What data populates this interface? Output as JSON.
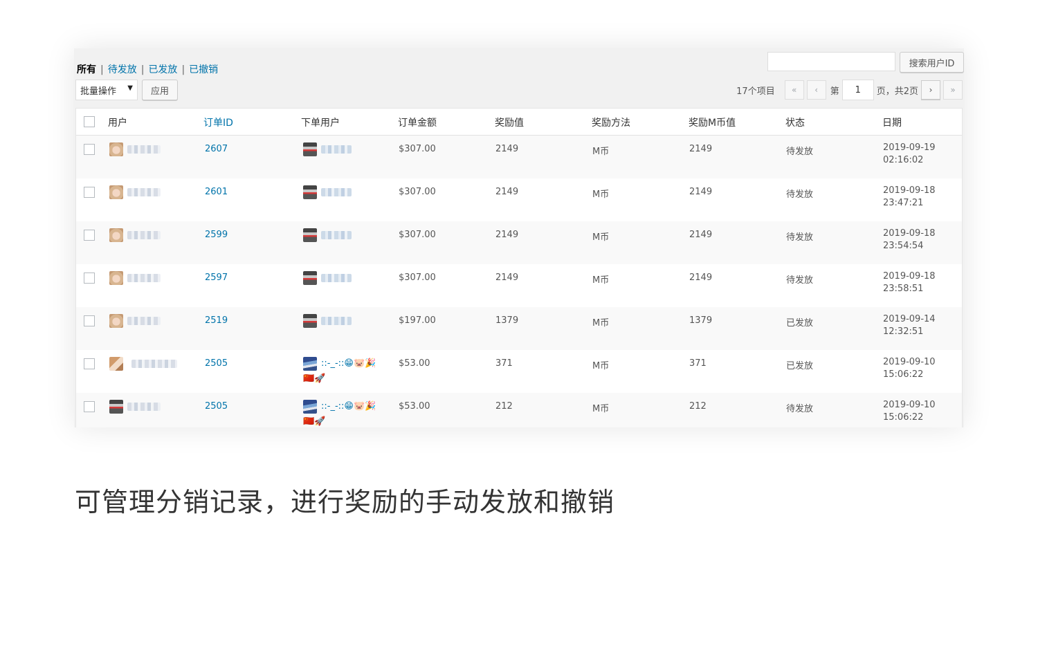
{
  "filters": {
    "all": "所有",
    "pending": "待发放",
    "issued": "已发放",
    "revoked": "已撤销",
    "separator": "|"
  },
  "search": {
    "input_value": "",
    "button_label": "搜索用户ID"
  },
  "bulk": {
    "select_label": "批量操作",
    "apply_label": "应用"
  },
  "pagination": {
    "items_count": "17个项目",
    "first": "«",
    "prev": "‹",
    "page_prefix": "第",
    "current_page": "1",
    "page_suffix": "页，共2页",
    "next": "›",
    "last": "»"
  },
  "columns": {
    "user": "用户",
    "order_id": "订单ID",
    "buyer": "下单用户",
    "amount": "订单金额",
    "reward_value": "奖励值",
    "reward_method": "奖励方法",
    "reward_coin": "奖励M币值",
    "status": "状态",
    "date": "日期"
  },
  "rows": [
    {
      "user_avatar": "girl-avatar",
      "order_id": "2607",
      "buyer_avatar": "robot-avatar",
      "buyer_name": "",
      "amount": "$307.00",
      "reward_value": "2149",
      "reward_method": "M币",
      "reward_coin": "2149",
      "status": "待发放",
      "date": "2019-09-19",
      "time": "02:16:02"
    },
    {
      "user_avatar": "girl-avatar",
      "order_id": "2601",
      "buyer_avatar": "robot-avatar",
      "buyer_name": "",
      "amount": "$307.00",
      "reward_value": "2149",
      "reward_method": "M币",
      "reward_coin": "2149",
      "status": "待发放",
      "date": "2019-09-18",
      "time": "23:47:21"
    },
    {
      "user_avatar": "girl-avatar",
      "order_id": "2599",
      "buyer_avatar": "robot-avatar",
      "buyer_name": "",
      "amount": "$307.00",
      "reward_value": "2149",
      "reward_method": "M币",
      "reward_coin": "2149",
      "status": "待发放",
      "date": "2019-09-18",
      "time": "23:54:54"
    },
    {
      "user_avatar": "girl-avatar",
      "order_id": "2597",
      "buyer_avatar": "robot-avatar",
      "buyer_name": "",
      "amount": "$307.00",
      "reward_value": "2149",
      "reward_method": "M币",
      "reward_coin": "2149",
      "status": "待发放",
      "date": "2019-09-18",
      "time": "23:58:51"
    },
    {
      "user_avatar": "girl-avatar",
      "order_id": "2519",
      "buyer_avatar": "robot-avatar",
      "buyer_name": "",
      "amount": "$197.00",
      "reward_value": "1379",
      "reward_method": "M币",
      "reward_coin": "1379",
      "status": "已发放",
      "date": "2019-09-14",
      "time": "12:32:51"
    },
    {
      "user_avatar": "boy-avatar",
      "order_id": "2505",
      "buyer_avatar": "mountain-avatar",
      "buyer_name": "::-_-::😁🐷🎉",
      "buyer_name_line2": "🇨🇳🚀",
      "amount": "$53.00",
      "reward_value": "371",
      "reward_method": "M币",
      "reward_coin": "371",
      "status": "已发放",
      "date": "2019-09-10",
      "time": "15:06:22"
    },
    {
      "user_avatar": "robot-avatar",
      "order_id": "2505",
      "buyer_avatar": "mountain-avatar",
      "buyer_name": "::-_-::😁🐷🎉",
      "buyer_name_line2": "🇨🇳🚀",
      "amount": "$53.00",
      "reward_value": "212",
      "reward_method": "M币",
      "reward_coin": "212",
      "status": "待发放",
      "date": "2019-09-10",
      "time": "15:06:22"
    }
  ],
  "caption": "可管理分销记录，进行奖励的手动发放和撤销"
}
